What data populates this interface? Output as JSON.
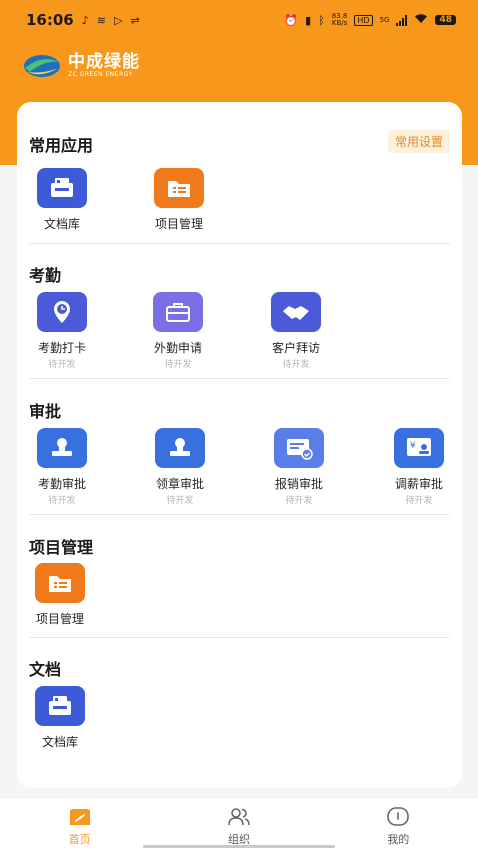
{
  "status_bar": {
    "time": "16:06",
    "net_speed_value": "83.8",
    "net_speed_unit": "KB/s",
    "hd": "HD",
    "network": "5G",
    "battery": "48"
  },
  "brand": {
    "name_cn": "中成绿能",
    "name_en": "ZC GREEN ENERGY"
  },
  "sections": {
    "common": {
      "title": "常用应用",
      "settings_label": "常用设置",
      "items": [
        {
          "label": "文档库",
          "icon": "archive-icon"
        },
        {
          "label": "项目管理",
          "icon": "folder-list-icon"
        }
      ]
    },
    "attendance": {
      "title": "考勤",
      "items": [
        {
          "label": "考勤打卡",
          "sub": "待开发",
          "icon": "location-clock-icon"
        },
        {
          "label": "外勤申请",
          "sub": "待开发",
          "icon": "briefcase-icon"
        },
        {
          "label": "客户拜访",
          "sub": "待开发",
          "icon": "handshake-icon"
        }
      ]
    },
    "approval": {
      "title": "审批",
      "items": [
        {
          "label": "考勤审批",
          "sub": "待开发",
          "icon": "stamp-icon"
        },
        {
          "label": "领章审批",
          "sub": "待开发",
          "icon": "stamp-icon"
        },
        {
          "label": "报销审批",
          "sub": "待开发",
          "icon": "reimburse-icon"
        },
        {
          "label": "调薪审批",
          "sub": "待开发",
          "icon": "salary-icon"
        }
      ]
    },
    "project": {
      "title": "项目管理",
      "items": [
        {
          "label": "项目管理",
          "icon": "folder-list-icon"
        }
      ]
    },
    "docs": {
      "title": "文档",
      "items": [
        {
          "label": "文档库",
          "icon": "archive-icon"
        }
      ]
    }
  },
  "tabbar": {
    "items": [
      {
        "label": "首页",
        "icon": "home-icon",
        "active": true
      },
      {
        "label": "组织",
        "icon": "people-icon",
        "active": false
      },
      {
        "label": "我的",
        "icon": "profile-icon",
        "active": false
      }
    ]
  },
  "colors": {
    "brand_orange": "#f7981d",
    "icon_blue": "#3d5bd9",
    "icon_orange": "#f07a1a",
    "pending_gray": "#b5b5b5"
  }
}
